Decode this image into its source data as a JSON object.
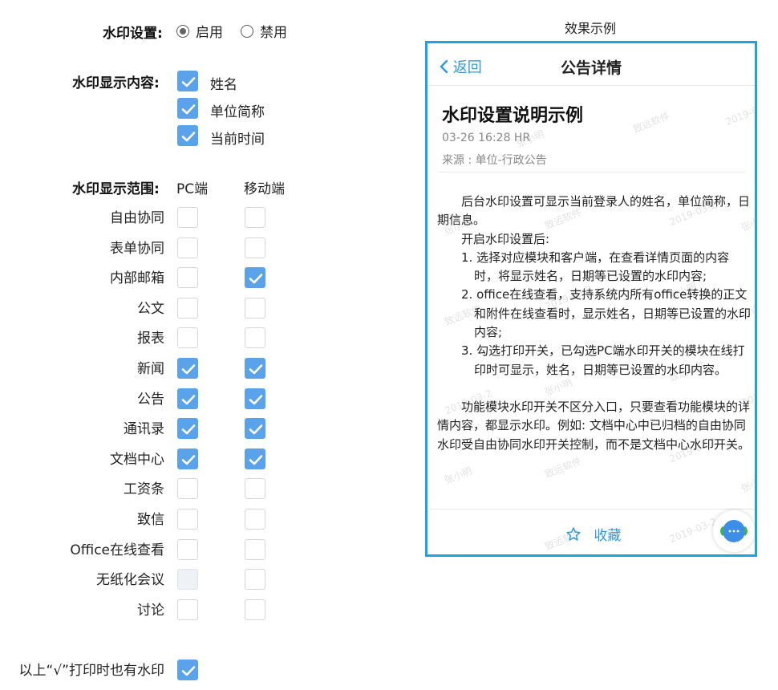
{
  "watermark_setting": {
    "label": "水印设置:",
    "options": [
      {
        "label": "启用",
        "selected": true
      },
      {
        "label": "禁用",
        "selected": false
      }
    ]
  },
  "display_content": {
    "label": "水印显示内容:",
    "items": [
      {
        "label": "姓名",
        "checked": true
      },
      {
        "label": "单位简称",
        "checked": true
      },
      {
        "label": "当前时间",
        "checked": true
      }
    ]
  },
  "display_scope": {
    "label": "水印显示范围:",
    "col_pc": "PC端",
    "col_mobile": "移动端",
    "rows": [
      {
        "label": "自由协同",
        "pc": false,
        "mobile": false
      },
      {
        "label": "表单协同",
        "pc": false,
        "mobile": false
      },
      {
        "label": "内部邮箱",
        "pc": false,
        "mobile": true
      },
      {
        "label": "公文",
        "pc": false,
        "mobile": false
      },
      {
        "label": "报表",
        "pc": false,
        "mobile": false
      },
      {
        "label": "新闻",
        "pc": true,
        "mobile": true
      },
      {
        "label": "公告",
        "pc": true,
        "mobile": true
      },
      {
        "label": "通讯录",
        "pc": true,
        "mobile": true
      },
      {
        "label": "文档中心",
        "pc": true,
        "mobile": true
      },
      {
        "label": "工资条",
        "pc": false,
        "mobile": false
      },
      {
        "label": "致信",
        "pc": false,
        "mobile": false
      },
      {
        "label": "Office在线查看",
        "pc": false,
        "mobile": false
      },
      {
        "label": "无纸化会议",
        "pc": false,
        "pc_disabled": true,
        "mobile": false
      },
      {
        "label": "讨论",
        "pc": false,
        "mobile": false
      }
    ]
  },
  "print_option": {
    "label": "以上“√”打印时也有水印",
    "checked": true
  },
  "preview": {
    "caption": "效果示例",
    "back_label": "返回",
    "header_title": "公告详情",
    "doc_title": "水印设置说明示例",
    "meta_line": "03-26 16:28  HR",
    "source_line": "来源 : 单位-行政公告",
    "paragraphs": [
      "后台水印设置可显示当前登录人的姓名，单位简称，日期信息。",
      "开启水印设置后:"
    ],
    "list": [
      "1. 选择对应模块和客户端，在查看详情页面的内容时，将显示姓名，日期等已设置的水印内容;",
      "2. office在线查看，支持系统内所有office转换的正文和附件在线查看时，显示姓名，日期等已设置的水印内容;",
      "3. 勾选打印开关，已勾选PC端水印开关的模块在线打印时可显示，姓名，日期等已设置的水印内容。"
    ],
    "closing": "功能模块水印开关不区分入口，只要查看功能模块的详情内容，都显示水印。例如: 文档中心中已归档的自由协同水印受自由协同水印开关控制，而不是文档中心水印开关。",
    "footer_label": "收藏",
    "watermarks": [
      "张小明",
      "致远软件",
      "2019-03-2"
    ]
  },
  "colors": {
    "accent": "#5aa2ea",
    "phone_border": "#1aa3e6",
    "link": "#2b9ae2"
  }
}
